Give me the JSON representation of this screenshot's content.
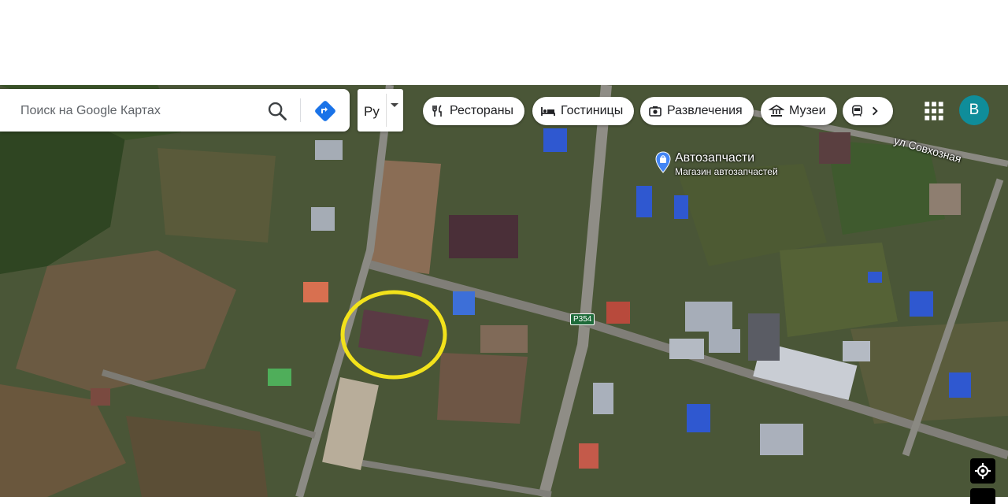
{
  "search": {
    "placeholder": "Поиск на Google Картах",
    "search_icon": "search-icon",
    "directions_icon": "directions-icon"
  },
  "language": {
    "code": "Ру"
  },
  "categories": [
    {
      "label": "Рестораны",
      "icon": "restaurant-icon"
    },
    {
      "label": "Гостиницы",
      "icon": "hotel-icon"
    },
    {
      "label": "Развлечения",
      "icon": "camera-icon"
    },
    {
      "label": "Музеи",
      "icon": "museum-icon"
    }
  ],
  "more_categories": {
    "icon": "transit-icon",
    "chevron": "chevron-right-icon"
  },
  "account": {
    "initial": "B",
    "color": "#0f8d9a"
  },
  "apps_icon": "apps-grid-icon",
  "map": {
    "poi": {
      "title": "Автозапчасти",
      "subtitle": "Магазин автозапчастей",
      "icon": "shopping-bag-pin-icon"
    },
    "street_label": "ул Совхозная",
    "route_label": "Р354",
    "highlight_color": "#f2e21b",
    "my_location_icon": "my-location-icon"
  }
}
